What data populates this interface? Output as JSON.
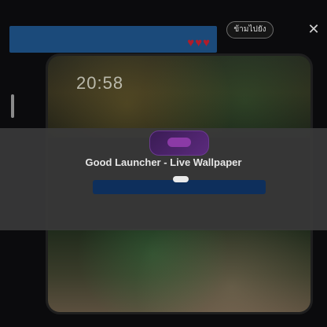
{
  "ad": {
    "banner_text": "",
    "hearts": "♥♥♥",
    "skip_label": "ข้ามไปยัง",
    "close_label": "✕"
  },
  "phone": {
    "time": "20:58",
    "date": ""
  },
  "app": {
    "name": "Good Launcher - Live Wallpaper",
    "rating_text": "",
    "install_label": ""
  },
  "colors": {
    "banner_bg": "#1b4a7a",
    "install_bg": "#0e2f5c",
    "card_bg": "#3a3a3a",
    "heart": "#b01c2a"
  }
}
